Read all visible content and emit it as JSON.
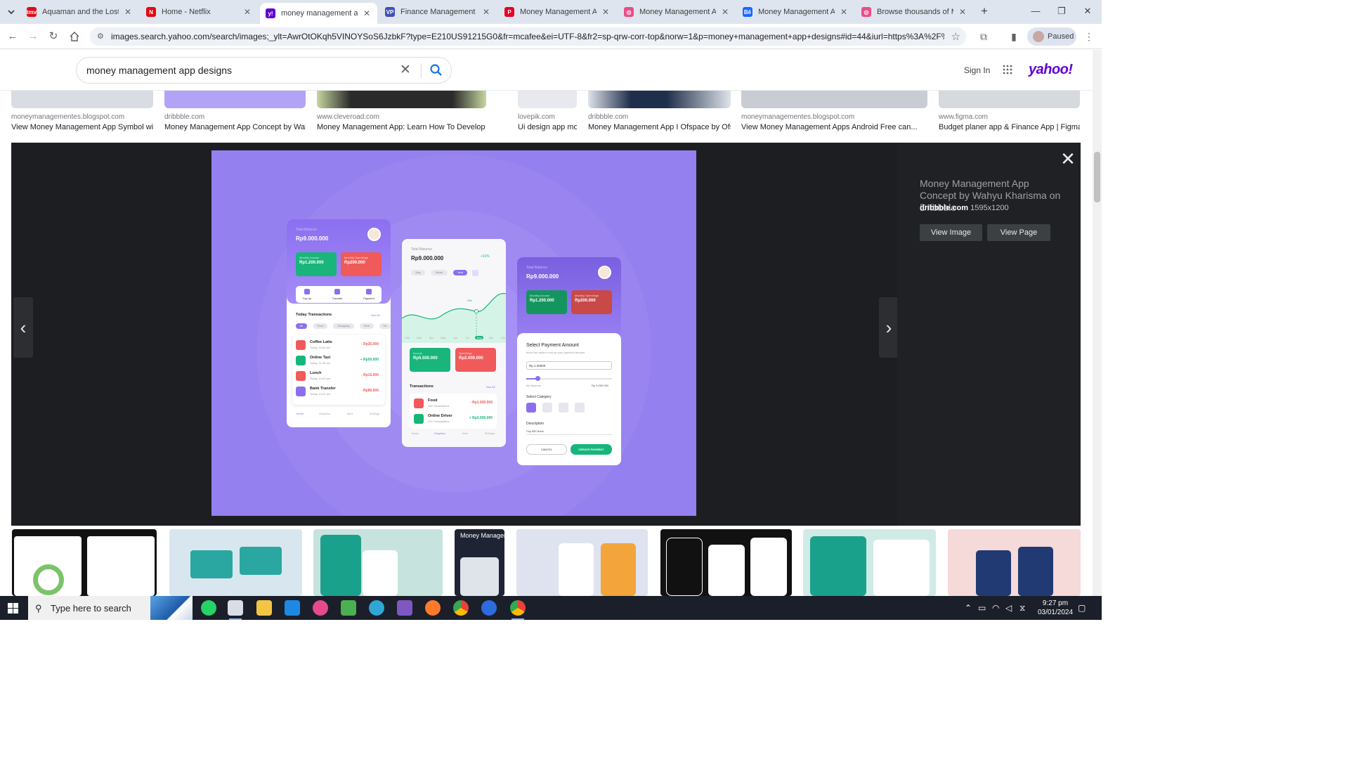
{
  "browser": {
    "tabs": [
      {
        "label": "Aquaman and the Lost Ki",
        "favicon_color": "#e50914",
        "favicon_text": "tmv"
      },
      {
        "label": "Home - Netflix",
        "favicon_color": "#e50914",
        "favicon_text": "N"
      },
      {
        "label": "money management app",
        "favicon_color": "#6001d2",
        "favicon_text": "y!"
      },
      {
        "label": "Finance Management | M",
        "favicon_color": "#3f51b5",
        "favicon_text": "VP"
      },
      {
        "label": "Money Management App",
        "favicon_color": "#e60023",
        "favicon_text": "P"
      },
      {
        "label": "Money Management App",
        "favicon_color": "#ea4c89",
        "favicon_text": "◎"
      },
      {
        "label": "Money Management App",
        "favicon_color": "#1769ff",
        "favicon_text": "Bē"
      },
      {
        "label": "Browse thousands of Mo",
        "favicon_color": "#ea4c89",
        "favicon_text": "◎"
      }
    ],
    "active_tab_index": 2,
    "url": "images.search.yahoo.com/search/images;_ylt=AwrOtOKqh5VINOYSoS6JzbkF?type=E210US91215G0&fr=mcafee&ei=UTF-8&fr2=sp-qrw-corr-top&norw=1&p=money+management+app+designs#id=44&iurl=https%3A%2F%2Fcdn.dr...",
    "profile_status": "Paused"
  },
  "yahoo": {
    "query": "money management app designs",
    "sign_in": "Sign In",
    "logo": "yahoo!"
  },
  "results": [
    {
      "source": "moneymanagementes.blogspot.com",
      "title": "View Money Management App Symbol withi..."
    },
    {
      "source": "dribbble.com",
      "title": "Money Management App Concept by Wahyu..."
    },
    {
      "source": "www.cleveroad.com",
      "title": "Money Management App: Learn How To Develop A..."
    },
    {
      "source": "lovepik.com",
      "title": "Ui design app mobile fin..."
    },
    {
      "source": "dribbble.com",
      "title": "Money Management App I Ofspace by Ofspa..."
    },
    {
      "source": "moneymanagementes.blogspot.com",
      "title": "View Money Management Apps Android Free can..."
    },
    {
      "source": "www.figma.com",
      "title": "Budget planer app & Finance App | Figma..."
    }
  ],
  "preview": {
    "title": "Money Management App Concept by Wahyu Kharisma on Dribbble",
    "domain": "dribbble.com",
    "dimensions": "1595x1200",
    "view_image": "View Image",
    "view_page": "View Page"
  },
  "mockup": {
    "phone1": {
      "total_label": "Total Balance",
      "total": "Rp9.000.000",
      "income_label": "Monthly Income",
      "income": "Rp1.200.000",
      "spend_label": "Monthly Spendings",
      "spend": "Rp200.000",
      "actions": [
        "Top Up",
        "Transfer",
        "Payment"
      ],
      "section": "Today Transactions",
      "see_all": "See All",
      "chips": [
        "All",
        "Food",
        "Shopping",
        "Rent",
        "He"
      ],
      "transactions": [
        {
          "name": "Coffee Latte",
          "time": "Today, 10:00 am",
          "amount": "- Rp25.000",
          "color": "#f05a5a"
        },
        {
          "name": "Online Taxi",
          "time": "Today, 11:30 am",
          "amount": "+ Rp50.000",
          "color": "#16b67a"
        },
        {
          "name": "Lunch",
          "time": "Today, 12:00 pm",
          "amount": "- Rp15.000",
          "color": "#f05a5a"
        },
        {
          "name": "Bank Transfer",
          "time": "Today, 13:00 pm",
          "amount": "- Rp80.000",
          "color": "#8b6ff0"
        }
      ],
      "nav": [
        "Home",
        "Graphics",
        "Alert",
        "Settings"
      ]
    },
    "phone2": {
      "total_label": "Total Balance",
      "total": "Rp9.000.000",
      "change": "+11%",
      "periods": [
        "Day",
        "Week",
        "Year"
      ],
      "marker": "+5%",
      "months": [
        "Feb",
        "Mar",
        "Apr",
        "May",
        "Jun",
        "Jul",
        "Aug",
        "Sep",
        "Oct"
      ],
      "income_label": "Income",
      "income": "Rp5.500.000",
      "spend_label": "Spendings",
      "spend": "Rp2.000.000",
      "section": "Transactions",
      "see_all": "See All",
      "transactions": [
        {
          "name": "Food",
          "count": "155 Transactions",
          "amount": "- Rp1.000.000",
          "color": "#f05a5a"
        },
        {
          "name": "Online Driver",
          "count": "202 Transactions",
          "amount": "+ Rp3.000.000",
          "color": "#16b67a"
        }
      ],
      "nav": [
        "Home",
        "Graphics",
        "Alert",
        "Settings"
      ]
    },
    "phone3": {
      "total_label": "Total Balance",
      "total": "Rp9.000.000",
      "income_label": "Monthly Income",
      "income": "Rp1.200.000",
      "spend_label": "Monthly Spendings",
      "spend": "Rp200.000",
      "sheet_title": "Select Payment Amount",
      "sheet_sub": "Move the slider to set up your payment amount",
      "amount": "Rp 1.20000",
      "my_balance": "My Balance",
      "balance_value": "Rp 3.000.000",
      "select_category": "Select Category",
      "description": "Description",
      "desc_value": "Pay BRI Bank",
      "cancel": "CANCEL",
      "create": "CREATE PAYMENT"
    }
  },
  "taskbar": {
    "search_placeholder": "Type here to search",
    "time": "9:27 pm",
    "date": "03/01/2024"
  }
}
